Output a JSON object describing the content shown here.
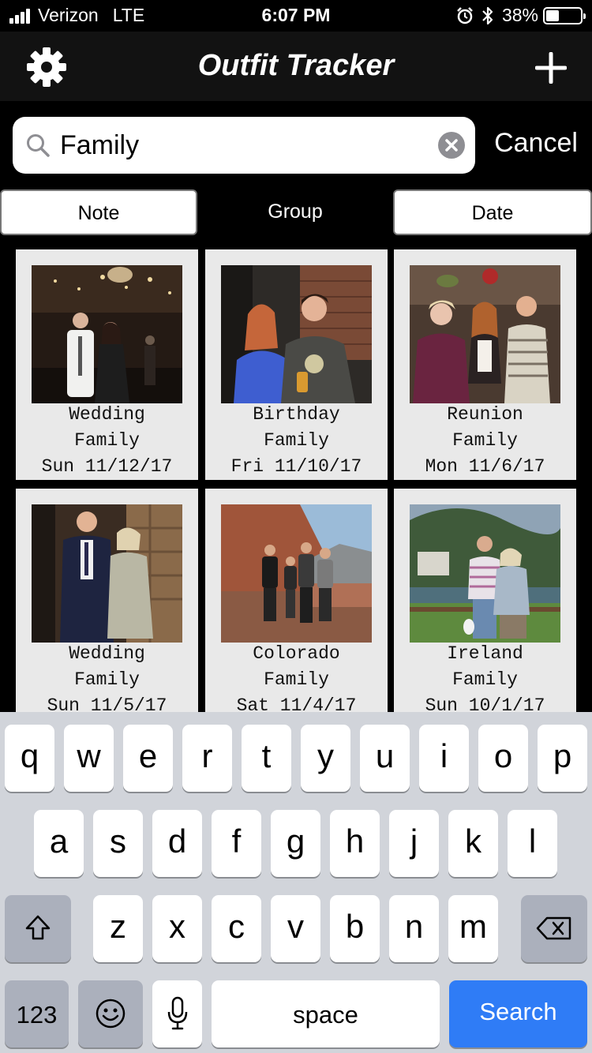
{
  "status_bar": {
    "carrier": "Verizon",
    "network": "LTE",
    "time": "6:07 PM",
    "battery": "38%",
    "battery_level": 0.38,
    "icons": [
      "signal-icon",
      "alarm-icon",
      "bluetooth-icon",
      "battery-icon"
    ]
  },
  "nav": {
    "title": "Outfit Tracker",
    "left_icon": "gear-icon",
    "right_icon": "plus-icon"
  },
  "search": {
    "value": "Family",
    "cancel_label": "Cancel"
  },
  "segments": [
    "Note",
    "Group",
    "Date"
  ],
  "selected_segment": "Group",
  "outfits": [
    {
      "event": "Wedding",
      "group": "Family",
      "date": "Sun 11/12/17"
    },
    {
      "event": "Birthday",
      "group": "Family",
      "date": "Fri 11/10/17"
    },
    {
      "event": "Reunion",
      "group": "Family",
      "date": "Mon 11/6/17"
    },
    {
      "event": "Wedding",
      "group": "Family",
      "date": "Sun 11/5/17"
    },
    {
      "event": "Colorado",
      "group": "Family",
      "date": "Sat 11/4/17"
    },
    {
      "event": "Ireland",
      "group": "Family",
      "date": "Sun 10/1/17"
    }
  ],
  "keyboard": {
    "row1": [
      "q",
      "w",
      "e",
      "r",
      "t",
      "y",
      "u",
      "i",
      "o",
      "p"
    ],
    "row2": [
      "a",
      "s",
      "d",
      "f",
      "g",
      "h",
      "j",
      "k",
      "l"
    ],
    "row3": [
      "z",
      "x",
      "c",
      "v",
      "b",
      "n",
      "m"
    ],
    "numbers_label": "123",
    "space_label": "space",
    "search_label": "Search",
    "icons": [
      "shift-icon",
      "backspace-icon",
      "emoji-icon",
      "microphone-icon"
    ]
  },
  "colors": {
    "background": "#000000",
    "card": "#e9e9e9",
    "keyboard": "#d1d4da",
    "search_key": "#2f7cf6"
  }
}
